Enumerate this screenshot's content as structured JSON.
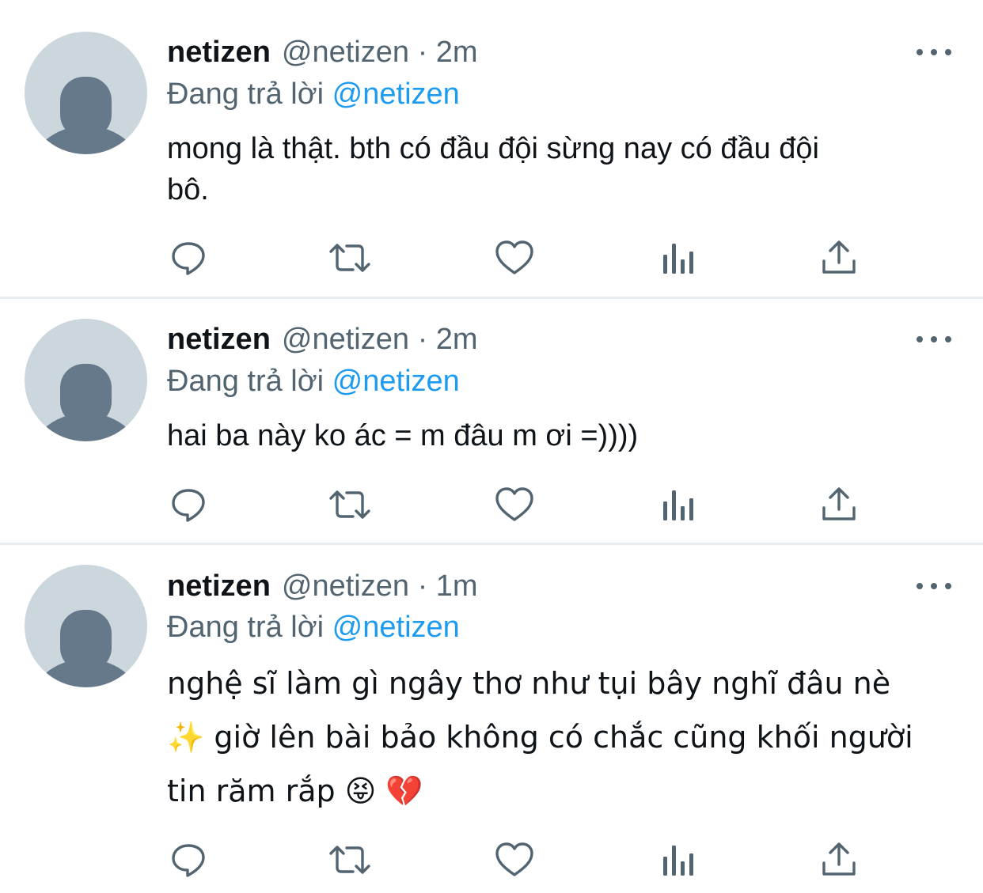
{
  "tweets": [
    {
      "display_name": "netizen",
      "handle_meta": "@netizen · 2m",
      "reply_prefix": "Đang trả lời",
      "reply_handle": "@netizen",
      "text": "mong là thật. bth có đầu đội sừng nay có đầu đội\nbô."
    },
    {
      "display_name": "netizen",
      "handle_meta": "@netizen · 2m",
      "reply_prefix": "Đang trả lời",
      "reply_handle": "@netizen",
      "text": "hai ba này ko ác = m đâu m ơi =))))"
    },
    {
      "display_name": "netizen",
      "handle_meta": "@netizen · 1m",
      "reply_prefix": "Đang trả lời",
      "reply_handle": "@netizen",
      "text": "nghệ sĩ làm gì ngây thơ như tụi bây nghĩ đâu nè\n✨ giờ lên bài bảo không có chắc cũng khối người\ntin răm rắp 😝 💔"
    }
  ],
  "icons": {
    "avatar": "default-avatar-icon",
    "more": "more-horizontal-icon",
    "reply": "reply-icon",
    "retweet": "retweet-icon",
    "like": "heart-icon",
    "views": "analytics-icon",
    "share": "share-icon"
  },
  "colors": {
    "text_primary": "#0f1419",
    "text_secondary": "#536471",
    "accent": "#1d9bf0",
    "avatar_bg": "#ccd6dd",
    "avatar_fg": "#66798a",
    "divider": "#e6ecf0"
  }
}
